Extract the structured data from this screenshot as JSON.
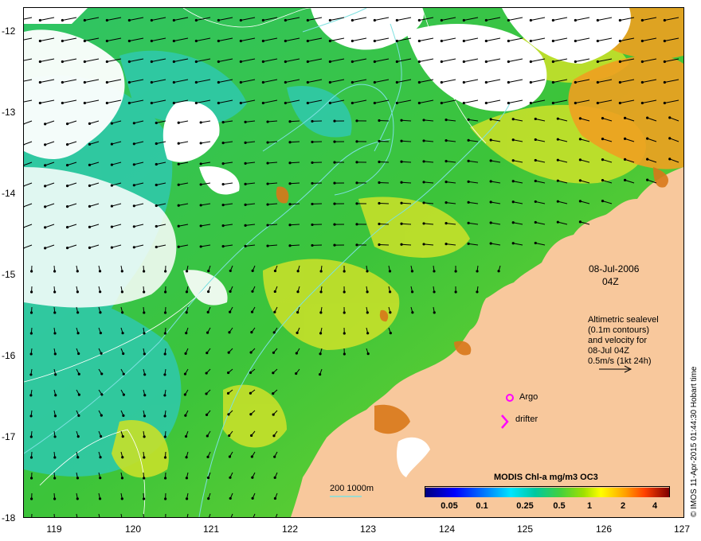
{
  "y_axis_labels": [
    "-12",
    "-13",
    "-14",
    "-15",
    "-16",
    "-17",
    "-18"
  ],
  "x_axis_labels": [
    "119",
    "120",
    "121",
    "122",
    "123",
    "124",
    "125",
    "126",
    "127"
  ],
  "date": "08-Jul-2006",
  "time": "04Z",
  "legend_block": [
    "Altimetric sealevel",
    "(0.1m contours)",
    "and velocity for",
    "08-Jul 04Z",
    "0.5m/s (1kt 24h)"
  ],
  "argo_label": "Argo",
  "drifter_label": "drifter",
  "bathymetry_label": "200  1000m",
  "colorbar": {
    "title": "MODIS Chl-a mg/m3 OC3",
    "ticks": [
      "0.05",
      "0.1",
      "0.25",
      "0.5",
      "1",
      "2",
      "4"
    ],
    "colors": [
      "#00007f",
      "#0000ff",
      "#0080ff",
      "#00e5ff",
      "#00c8a0",
      "#40d040",
      "#a0e000",
      "#ffff00",
      "#ffa000",
      "#ff4000",
      "#b00000",
      "#7f0000"
    ]
  },
  "credit": "© IMOS 11-Apr-2015 01:44:30 Hobart time",
  "colors": {
    "land": "#f8c89c",
    "cloud": "#ffffff",
    "ocean_green": "#38c13a",
    "ocean_teal": "#2cc9b0",
    "ocean_yellow": "#c8e028",
    "coast_orange": "#e07a18",
    "contour": "#7ce0e0",
    "argo_marker": "#ff00ff"
  }
}
